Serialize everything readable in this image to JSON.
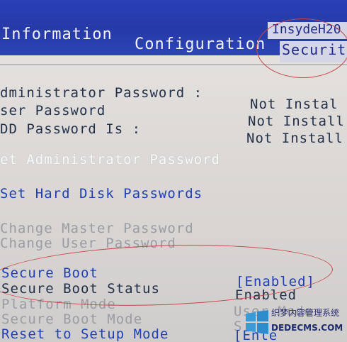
{
  "header": {
    "brand": "InsydeH20",
    "tabs": [
      {
        "label": "Information"
      },
      {
        "label": "Configuration"
      },
      {
        "label": "Securit"
      }
    ]
  },
  "status": {
    "admin_label": "dministrator Password :",
    "admin_value": "Not Instal",
    "user_label": "ser Password",
    "user_value": "Not Install",
    "hdd_label": "DD Password Is :",
    "hdd_value": "Not Install"
  },
  "actions": {
    "set_admin": "et Administrator Password",
    "set_hdd": "Set Hard Disk Passwords",
    "change_master": "Change Master Password",
    "change_user": "Change User Password"
  },
  "secure_boot": {
    "label": "Secure Boot",
    "value": "[Enabled]",
    "status_label": "Secure Boot Status",
    "status_value": "Enabled",
    "platform_label": "Platform Mode",
    "platform_value": "User Mode",
    "mode_label": "Secure Boot Mode",
    "mode_value": "S",
    "reset_label": "Reset to Setup Mode",
    "reset_value": "[Ente"
  },
  "watermark": {
    "title": "织梦内容管理系统",
    "url": "DEDECMS.COM"
  },
  "colors": {
    "bar": "#2a3fb6",
    "selected_tab": "#d4d6e6",
    "text_blue": "#1f3fb3",
    "text_dark": "#22304a",
    "text_grey": "#9a9ca3",
    "annotation_red": "#c84545"
  }
}
